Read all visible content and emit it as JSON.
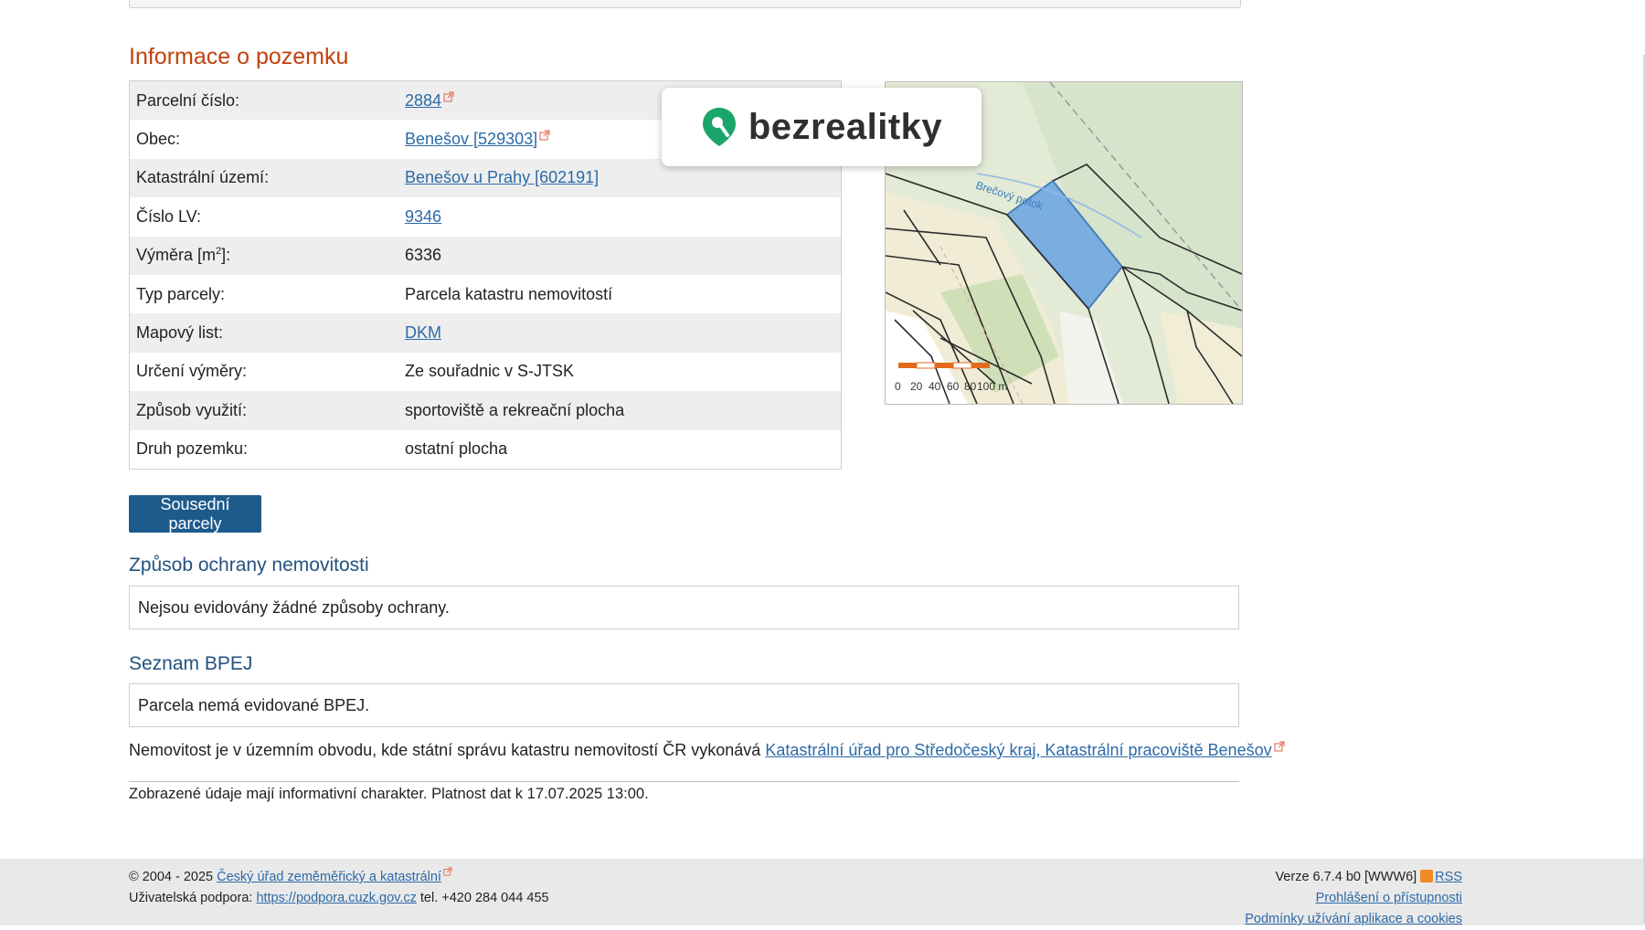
{
  "info": {
    "title": "Informace o pozemku",
    "rows": [
      {
        "label": "Parcelní číslo:",
        "value": "2884"
      },
      {
        "label": "Obec:",
        "value": "Benešov [529303]"
      },
      {
        "label": "Katastrální území:",
        "value": "Benešov u Prahy [602191]"
      },
      {
        "label": "Číslo LV:",
        "value": "9346"
      },
      {
        "label": "Výměra [m",
        "label_sup": "2",
        "label_tail": "]:",
        "value": "6336"
      },
      {
        "label": "Typ parcely:",
        "value": "Parcela katastru nemovitostí"
      },
      {
        "label": "Mapový list:",
        "value": "DKM"
      },
      {
        "label": "Určení výměry:",
        "value": "Ze souřadnic v S-JTSK"
      },
      {
        "label": "Způsob využití:",
        "value": "sportoviště a rekreační plocha"
      },
      {
        "label": "Druh pozemku:",
        "value": "ostatní plocha"
      }
    ]
  },
  "map": {
    "stream_label": "Brečový potok",
    "scale_labels": [
      "0",
      "20",
      "40",
      "60",
      "80",
      "100 m"
    ]
  },
  "watermark": {
    "text": "bezrealitky",
    "brand_color": "#1aa56b"
  },
  "buttons": {
    "neighbors": "Sousední parcely"
  },
  "protection": {
    "title": "Způsob ochrany nemovitosti",
    "text": "Nejsou evidovány žádné způsoby ochrany."
  },
  "bpej": {
    "title": "Seznam BPEJ",
    "text": "Parcela nemá evidované BPEJ."
  },
  "office": {
    "prefix": "Nemovitost je v územním obvodu, kde státní správu katastru nemovitostí ČR vykonává ",
    "link": "Katastrální úřad pro Středočeský kraj, Katastrální pracoviště Benešov"
  },
  "disclaimer": "Zobrazené údaje mají informativní charakter. Platnost dat k 17.07.2025 13:00.",
  "footer": {
    "copyright": "© 2004 - 2025 ",
    "copyright_link": "Český úřad zeměměřický a katastrální",
    "support_prefix": "Uživatelská podpora: ",
    "support_link": "https://podpora.cuzk.gov.cz",
    "support_phone": " tel. +420 284 044 455",
    "version": "Verze 6.7.4 b0 [WWW6]",
    "rss": "RSS",
    "accessibility": "Prohlášení o přístupnosti",
    "cookies": "Podmínky užívání aplikace a cookies"
  },
  "colors": {
    "section_title": "#c2410c",
    "subtitle": "#24527e",
    "link": "#2c6aa8",
    "button": "#1e5b8d",
    "parcel_fill": "#7aaee0"
  }
}
